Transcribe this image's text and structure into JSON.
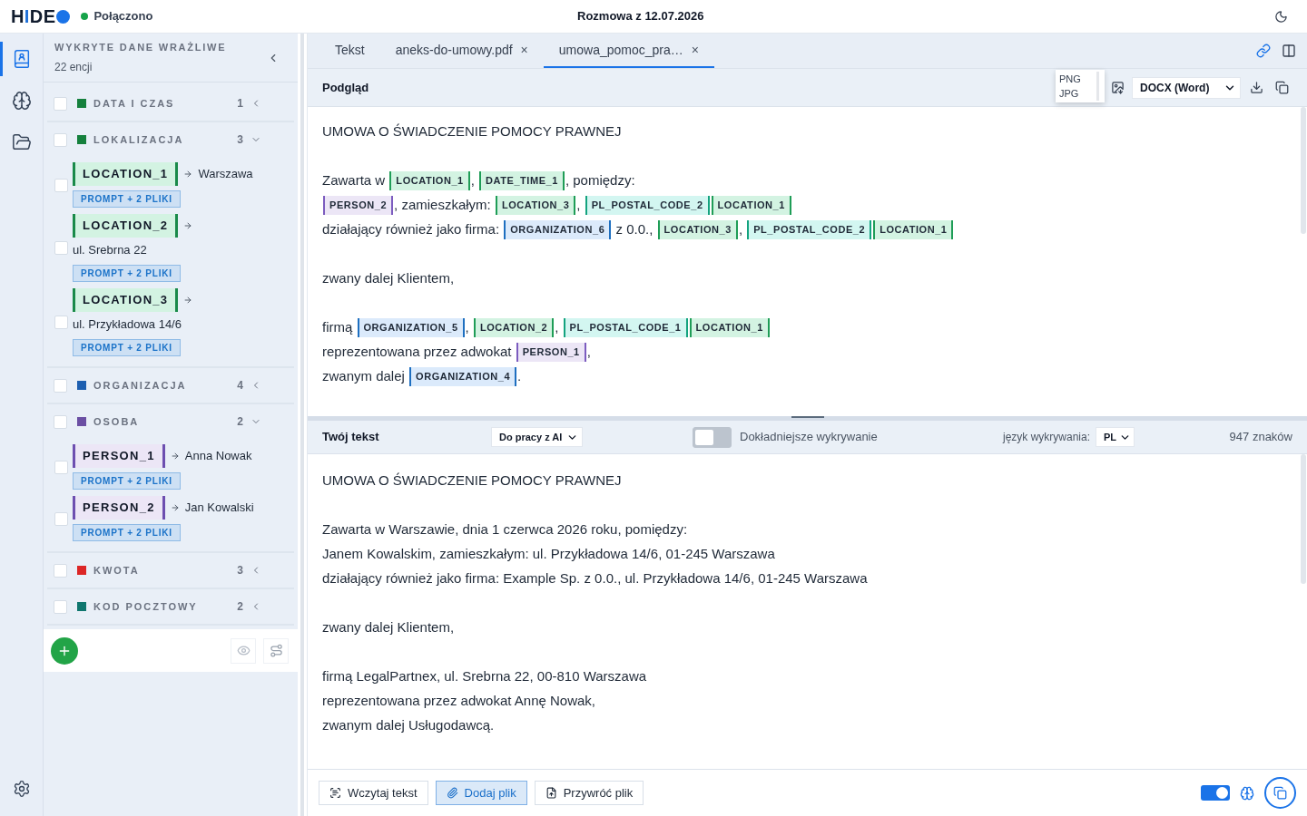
{
  "header": {
    "logo": [
      {
        "text": "H",
        "accent": false
      },
      {
        "text": "I",
        "accent": true
      },
      {
        "text": "DE",
        "accent": false
      }
    ],
    "status": {
      "label": "Połączono",
      "connected": true
    },
    "title": "Rozmowa z 12.07.2026"
  },
  "rail": [
    {
      "selected": true
    },
    {
      "selected": false
    },
    {
      "selected": false
    }
  ],
  "sidebar": {
    "title": "WYKRYTE DANE WRAŻLIWE",
    "subtitle": "22 encji",
    "categories": [
      {
        "name": "DATA I CZAS",
        "color": "#15803d",
        "count": "1",
        "checked": false,
        "expanded": false
      },
      {
        "name": "LOKALIZACJA",
        "color": "#15803d",
        "count": "3",
        "checked": false,
        "expanded": true,
        "entities": [
          {
            "tag": "LOCATION_1",
            "kind": "location",
            "value": "Warszawa",
            "badge": "PROMPT + 2 PLIKI",
            "checked": false
          },
          {
            "tag": "LOCATION_2",
            "kind": "location",
            "value": "ul. Srebrna 22",
            "badge": "PROMPT + 2 PLIKI",
            "checked": false
          },
          {
            "tag": "LOCATION_3",
            "kind": "location",
            "value": "ul. Przykładowa 14/6",
            "badge": "PROMPT + 2 PLIKI",
            "checked": false
          }
        ]
      },
      {
        "name": "ORGANIZACJA",
        "color": "#1d5fb0",
        "count": "4",
        "checked": false,
        "expanded": false
      },
      {
        "name": "OSOBA",
        "color": "#6b4fa3",
        "count": "2",
        "checked": false,
        "expanded": true,
        "entities": [
          {
            "tag": "PERSON_1",
            "kind": "person",
            "value": "Anna Nowak",
            "badge": "PROMPT + 2 PLIKI",
            "checked": false
          },
          {
            "tag": "PERSON_2",
            "kind": "person",
            "value": "Jan Kowalski",
            "badge": "PROMPT + 2 PLIKI",
            "checked": false
          }
        ]
      },
      {
        "name": "KWOTA",
        "color": "#dc2626",
        "count": "3",
        "checked": false,
        "expanded": false
      },
      {
        "name": "KOD POCZTOWY",
        "color": "#0f766e",
        "count": "2",
        "checked": false,
        "expanded": false
      }
    ]
  },
  "tabs": [
    {
      "label": "Tekst",
      "selected": false
    },
    {
      "label": "aneks-do-umowy.pdf",
      "close": "×",
      "selected": false
    },
    {
      "label": "umowa_pomoc_pra…",
      "close": "×",
      "selected": true
    }
  ],
  "preview": {
    "title": "Podgląd",
    "image_menu": [
      "PNG",
      "JPG"
    ],
    "format": "DOCX (Word)",
    "paragraphs": [
      [
        [
          {
            "kind": "text",
            "text": "UMOWA O ŚWIADCZENIE POMOCY PRAWNEJ"
          }
        ]
      ],
      [
        [
          {
            "kind": "text",
            "text": "Zawarta w "
          },
          {
            "kind": "location",
            "text": "LOCATION_1"
          },
          {
            "kind": "text",
            "text": ", "
          },
          {
            "kind": "datetime",
            "text": "DATE_TIME_1"
          },
          {
            "kind": "text",
            "text": ", pomiędzy:"
          }
        ],
        [
          {
            "kind": "person",
            "text": "PERSON_2"
          },
          {
            "kind": "text",
            "text": ", zamieszkałym: "
          },
          {
            "kind": "location",
            "text": "LOCATION_3"
          },
          {
            "kind": "text",
            "text": ", "
          },
          {
            "kind": "postal",
            "text": "PL_POSTAL_CODE_2"
          },
          {
            "kind": "location",
            "text": "LOCATION_1"
          }
        ],
        [
          {
            "kind": "text",
            "text": "działający również jako firma: "
          },
          {
            "kind": "organization",
            "text": "ORGANIZATION_6"
          },
          {
            "kind": "text",
            "text": " z 0.0., "
          },
          {
            "kind": "location",
            "text": "LOCATION_3"
          },
          {
            "kind": "text",
            "text": ", "
          },
          {
            "kind": "postal",
            "text": "PL_POSTAL_CODE_2"
          },
          {
            "kind": "location",
            "text": "LOCATION_1"
          }
        ]
      ],
      [
        [
          {
            "kind": "text",
            "text": "zwany dalej Klientem,"
          }
        ]
      ],
      [
        [
          {
            "kind": "text",
            "text": "firmą "
          },
          {
            "kind": "organization",
            "text": "ORGANIZATION_5"
          },
          {
            "kind": "text",
            "text": ", "
          },
          {
            "kind": "location",
            "text": "LOCATION_2"
          },
          {
            "kind": "text",
            "text": ", "
          },
          {
            "kind": "postal",
            "text": "PL_POSTAL_CODE_1"
          },
          {
            "kind": "location",
            "text": "LOCATION_1"
          }
        ],
        [
          {
            "kind": "text",
            "text": "reprezentowana przez adwokat "
          },
          {
            "kind": "person",
            "text": "PERSON_1"
          },
          {
            "kind": "text",
            "text": ","
          }
        ],
        [
          {
            "kind": "text",
            "text": "zwanym dalej "
          },
          {
            "kind": "organization",
            "text": "ORGANIZATION_4"
          },
          {
            "kind": "text",
            "text": "."
          }
        ]
      ]
    ]
  },
  "editor": {
    "title": "Twój tekst",
    "mode": "Do pracy z AI",
    "precise": {
      "label": "Dokładniejsze wykrywanie",
      "on": false
    },
    "language_label": "język wykrywania:",
    "language": "PL",
    "char_count": "947 znaków",
    "paragraphs": [
      [
        "UMOWA O ŚWIADCZENIE POMOCY PRAWNEJ"
      ],
      [
        "Zawarta w Warszawie, dnia 1 czerwca 2026 roku, pomiędzy:",
        "Janem Kowalskim, zamieszkałym: ul. Przykładowa 14/6, 01-245 Warszawa",
        "działający również jako firma: Example Sp. z 0.0., ul. Przykładowa 14/6, 01-245 Warszawa"
      ],
      [
        "zwany dalej Klientem,"
      ],
      [
        "firmą LegalPartnex, ul. Srebrna 22, 00-810 Warszawa",
        "reprezentowana przez adwokat Annę Nowak,",
        "zwanym dalej Usługodawcą."
      ]
    ]
  },
  "footer": {
    "buttons": [
      {
        "label": "Wczytaj tekst",
        "kind": "scan",
        "highlighted": false
      },
      {
        "label": "Dodaj plik",
        "kind": "attach",
        "highlighted": true
      },
      {
        "label": "Przywróć plik",
        "kind": "restore",
        "highlighted": false
      }
    ],
    "ai_mode": {
      "on": true
    }
  }
}
